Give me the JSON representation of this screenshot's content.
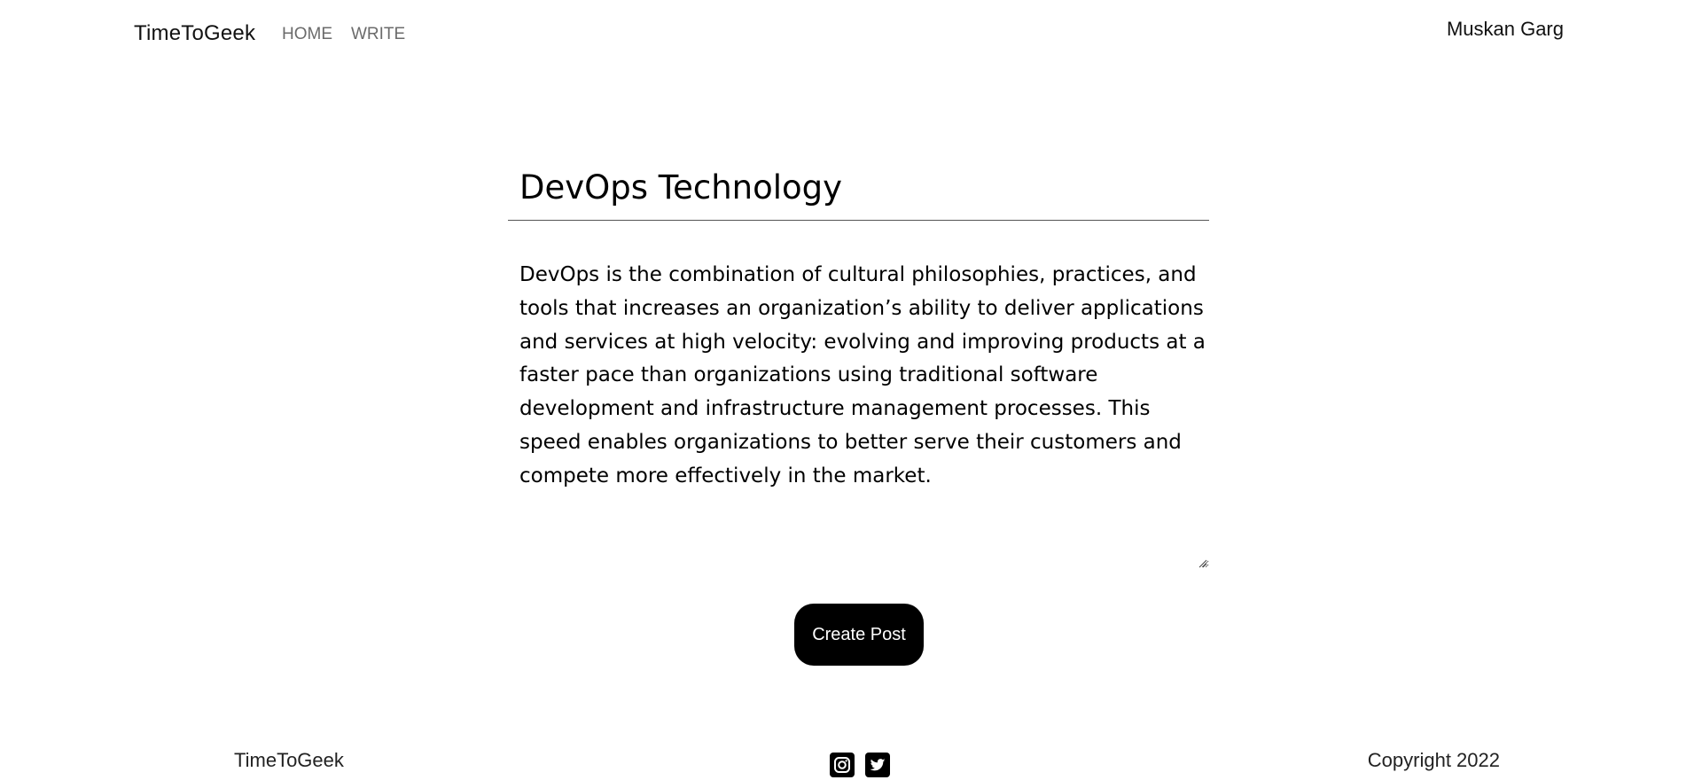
{
  "header": {
    "brand": "TimeToGeek",
    "nav": {
      "home": "HOME",
      "write": "WRITE"
    },
    "user_name": "Muskan Garg"
  },
  "editor": {
    "title_value": "DevOps Technology",
    "body_value": "DevOps is the combination of cultural philosophies, practices, and tools that increases an organization’s ability to deliver applications and services at high velocity: evolving and improving products at a faster pace than organizations using traditional software development and infrastructure management processes. This speed enables organizations to better serve their customers and compete more effectively in the market.",
    "submit_label": "Create Post"
  },
  "footer": {
    "brand": "TimeToGeek",
    "social_icons": [
      "instagram-icon",
      "twitter-icon"
    ],
    "copyright": "Copyright 2022"
  }
}
